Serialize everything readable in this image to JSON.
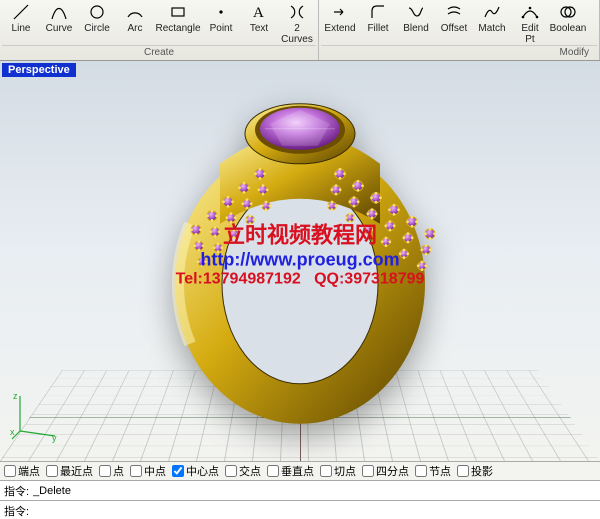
{
  "toolbar": {
    "groups": [
      {
        "label": "Create",
        "tools": [
          {
            "name": "line",
            "label": "Line"
          },
          {
            "name": "curve",
            "label": "Curve"
          },
          {
            "name": "circle",
            "label": "Circle"
          },
          {
            "name": "arc",
            "label": "Arc"
          },
          {
            "name": "rectangle",
            "label": "Rectangle"
          },
          {
            "name": "point",
            "label": "Point"
          },
          {
            "name": "text",
            "label": "Text"
          },
          {
            "name": "2curves",
            "label": "2\nCurves"
          }
        ]
      },
      {
        "label": "Modify",
        "tools": [
          {
            "name": "extend",
            "label": "Extend"
          },
          {
            "name": "fillet",
            "label": "Fillet"
          },
          {
            "name": "blend",
            "label": "Blend"
          },
          {
            "name": "offset",
            "label": "Offset"
          },
          {
            "name": "match",
            "label": "Match"
          },
          {
            "name": "editpt",
            "label": "Edit\nPt"
          },
          {
            "name": "boolean",
            "label": "Boolean"
          }
        ]
      }
    ]
  },
  "viewport": {
    "label": "Perspective",
    "axes": {
      "x": "x",
      "y": "y",
      "z": "z"
    }
  },
  "watermark": {
    "line1": "立时视频教程网",
    "line2": "http://www.proeug.com",
    "line3_a": "Tel:13794987192",
    "line3_b": "QQ:397318799"
  },
  "snap": {
    "items": [
      {
        "label": "端点",
        "checked": false
      },
      {
        "label": "最近点",
        "checked": false
      },
      {
        "label": "点",
        "checked": false
      },
      {
        "label": "中点",
        "checked": false
      },
      {
        "label": "中心点",
        "checked": true
      },
      {
        "label": "交点",
        "checked": false
      },
      {
        "label": "垂直点",
        "checked": false
      },
      {
        "label": "切点",
        "checked": false
      },
      {
        "label": "四分点",
        "checked": false
      },
      {
        "label": "节点",
        "checked": false
      },
      {
        "label": "投影",
        "checked": false
      }
    ]
  },
  "command": {
    "prompt1": "指令:",
    "value1": "_Delete",
    "prompt2": "指令:",
    "value2": ""
  },
  "colors": {
    "gold_light": "#f5e06a",
    "gold_mid": "#c5a110",
    "gold_dark": "#6b4e00",
    "gem_purple_light": "#d89be8",
    "gem_purple_dark": "#8a3aa8"
  }
}
